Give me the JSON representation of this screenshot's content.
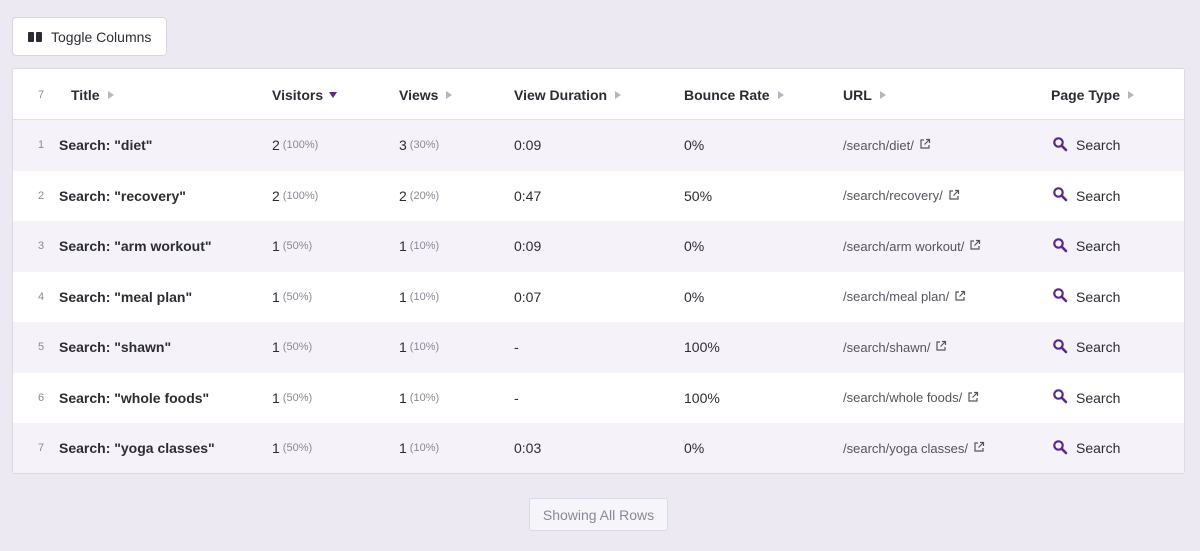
{
  "toolbar": {
    "toggle_columns_label": "Toggle Columns"
  },
  "table": {
    "row_count_label": "7",
    "headers": {
      "title": "Title",
      "visitors": "Visitors",
      "views": "Views",
      "view_duration": "View Duration",
      "bounce_rate": "Bounce Rate",
      "url": "URL",
      "page_type": "Page Type"
    },
    "sort": {
      "column": "visitors",
      "direction": "desc"
    },
    "rows": [
      {
        "n": "1",
        "title": "Search: \"diet\"",
        "visitors": "2",
        "visitors_pct": "(100%)",
        "views": "3",
        "views_pct": "(30%)",
        "duration": "0:09",
        "bounce": "0%",
        "url": "/search/diet/",
        "type": "Search"
      },
      {
        "n": "2",
        "title": "Search: \"recovery\"",
        "visitors": "2",
        "visitors_pct": "(100%)",
        "views": "2",
        "views_pct": "(20%)",
        "duration": "0:47",
        "bounce": "50%",
        "url": "/search/recovery/",
        "type": "Search"
      },
      {
        "n": "3",
        "title": "Search: \"arm workout\"",
        "visitors": "1",
        "visitors_pct": "(50%)",
        "views": "1",
        "views_pct": "(10%)",
        "duration": "0:09",
        "bounce": "0%",
        "url": "/search/arm workout/",
        "type": "Search"
      },
      {
        "n": "4",
        "title": "Search: \"meal plan\"",
        "visitors": "1",
        "visitors_pct": "(50%)",
        "views": "1",
        "views_pct": "(10%)",
        "duration": "0:07",
        "bounce": "0%",
        "url": "/search/meal plan/",
        "type": "Search"
      },
      {
        "n": "5",
        "title": "Search: \"shawn\"",
        "visitors": "1",
        "visitors_pct": "(50%)",
        "views": "1",
        "views_pct": "(10%)",
        "duration": "-",
        "bounce": "100%",
        "url": "/search/shawn/",
        "type": "Search"
      },
      {
        "n": "6",
        "title": "Search: \"whole foods\"",
        "visitors": "1",
        "visitors_pct": "(50%)",
        "views": "1",
        "views_pct": "(10%)",
        "duration": "-",
        "bounce": "100%",
        "url": "/search/whole foods/",
        "type": "Search"
      },
      {
        "n": "7",
        "title": "Search: \"yoga classes\"",
        "visitors": "1",
        "visitors_pct": "(50%)",
        "views": "1",
        "views_pct": "(10%)",
        "duration": "0:03",
        "bounce": "0%",
        "url": "/search/yoga classes/",
        "type": "Search"
      }
    ]
  },
  "footer": {
    "show_all_label": "Showing All Rows"
  },
  "icons": {
    "columns": "columns-icon",
    "external_link": "external-link-icon",
    "search": "search-icon"
  },
  "colors": {
    "accent": "#5b2a86",
    "background": "#ece9f3",
    "row_alt": "#f5f3f9"
  }
}
